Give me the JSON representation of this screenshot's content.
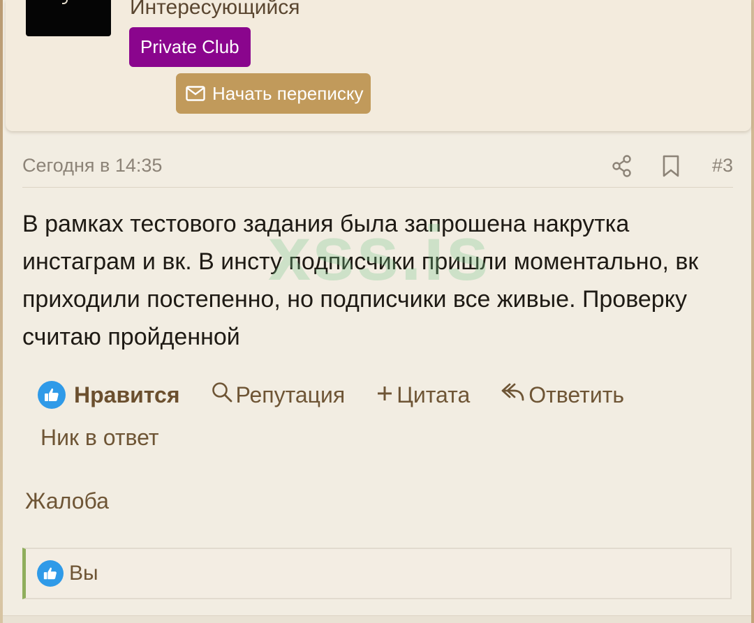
{
  "user_card": {
    "user_title": "Интересующийся",
    "badge": "Private Club",
    "message_button": "Начать переписку"
  },
  "post": {
    "date": "Сегодня в 14:35",
    "number": "#3",
    "body": "В рамках тестового задания была запрошена накрутка инстаграм и вк. В инсту подписчики пришли моментально, вк приходили постепенно, но подписчики все живые. Проверку считаю пройденной",
    "watermark": "xss.is"
  },
  "actions": {
    "like": "Нравится",
    "reputation": "Репутация",
    "quote": "Цитата",
    "reply": "Ответить",
    "nick_reply": "Ник в ответ",
    "report": "Жалоба"
  },
  "likes": {
    "who": "Вы"
  },
  "colors": {
    "badge_purple": "#8a058d",
    "button_gold": "#c19a5b",
    "like_blue": "#2f9ae8",
    "likes_accent_green": "#8fae5c"
  },
  "icons": [
    "envelope-icon",
    "share-icon",
    "bookmark-icon",
    "thumbs-up-icon",
    "search-icon",
    "plus-icon",
    "reply-arrow-icon"
  ]
}
